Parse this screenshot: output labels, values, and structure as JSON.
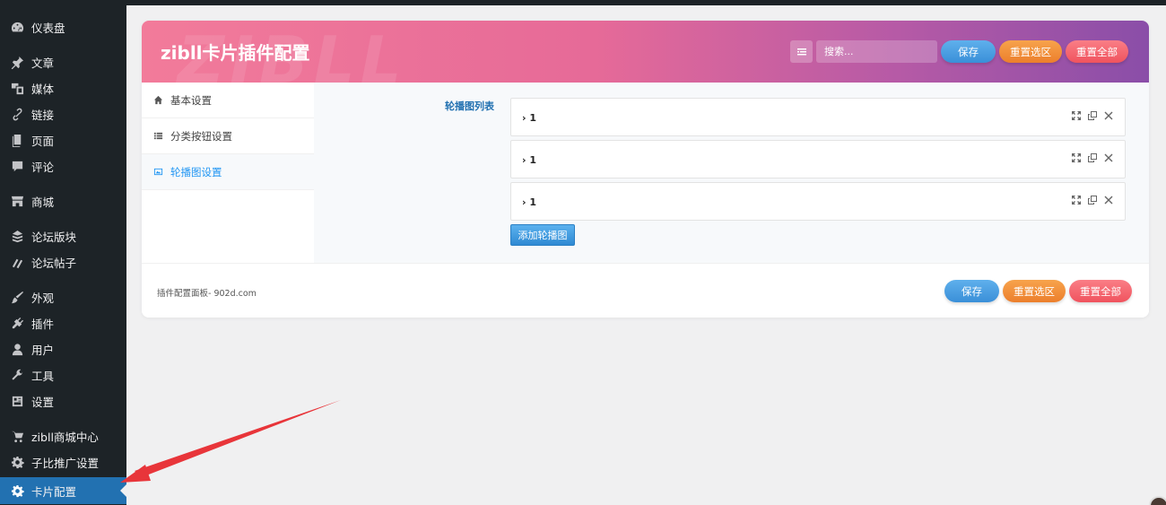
{
  "sidebar": {
    "items": [
      {
        "label": "仪表盘",
        "icon": "dashboard-icon"
      },
      {
        "label": "文章",
        "icon": "pin-icon"
      },
      {
        "label": "媒体",
        "icon": "media-icon"
      },
      {
        "label": "链接",
        "icon": "link-icon"
      },
      {
        "label": "页面",
        "icon": "page-icon"
      },
      {
        "label": "评论",
        "icon": "comment-icon"
      },
      {
        "label": "商城",
        "icon": "store-icon"
      },
      {
        "label": "论坛版块",
        "icon": "forum-icon"
      },
      {
        "label": "论坛帖子",
        "icon": "posts-icon"
      },
      {
        "label": "外观",
        "icon": "appearance-icon"
      },
      {
        "label": "插件",
        "icon": "plugin-icon"
      },
      {
        "label": "用户",
        "icon": "user-icon"
      },
      {
        "label": "工具",
        "icon": "wrench-icon"
      },
      {
        "label": "设置",
        "icon": "settings-icon"
      },
      {
        "label": "zibll商城中心",
        "icon": "cart-icon"
      },
      {
        "label": "子比推广设置",
        "icon": "gear-icon"
      },
      {
        "label": "卡片配置",
        "icon": "gear-icon"
      }
    ],
    "active_index": 16
  },
  "panel": {
    "title": "zibll卡片插件配置",
    "watermark": "ZIBLL",
    "search_placeholder": "搜索...",
    "buttons": {
      "save": "保存",
      "reset_section": "重置选区",
      "reset_all": "重置全部"
    }
  },
  "tabs": [
    {
      "label": "基本设置",
      "icon": "home-icon"
    },
    {
      "label": "分类按钮设置",
      "icon": "list-icon"
    },
    {
      "label": "轮播图设置",
      "icon": "image-icon"
    }
  ],
  "active_tab": 2,
  "content": {
    "field_label": "轮播图列表",
    "slides": [
      {
        "title": "1"
      },
      {
        "title": "1"
      },
      {
        "title": "1"
      }
    ],
    "add_button": "添加轮播图"
  },
  "footer": {
    "text": "插件配置面板- 902d.com",
    "buttons": {
      "save": "保存",
      "reset_section": "重置选区",
      "reset_all": "重置全部"
    }
  }
}
